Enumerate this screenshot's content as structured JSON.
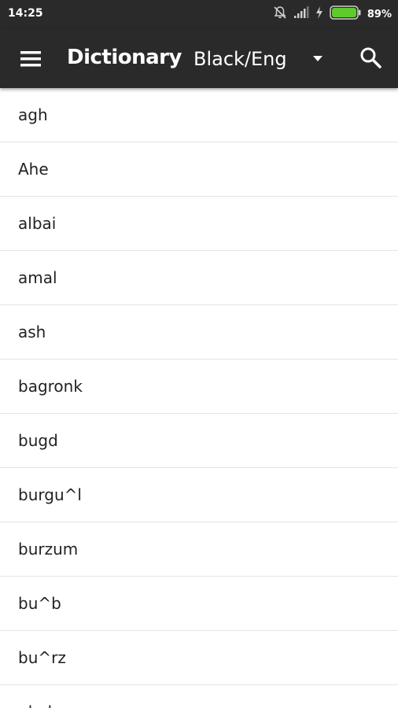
{
  "status_bar": {
    "time": "14:25",
    "battery_percent": "89%",
    "icons": [
      "notifications-muted-icon",
      "signal-icon",
      "charging-icon",
      "battery-icon"
    ],
    "battery_color": "#5ecb2a"
  },
  "toolbar": {
    "background": "#2a2a2a",
    "menu_icon": "hamburger-menu-icon",
    "title": "Dictionary",
    "language": "Black/Eng",
    "search_icon": "search-icon"
  },
  "words": [
    "agh",
    "Ahe",
    "albai",
    "amal",
    "ash",
    "bagronk",
    "bugd",
    "burgu^l",
    "burzum",
    "bu^b",
    "bu^rz",
    "ghak"
  ]
}
